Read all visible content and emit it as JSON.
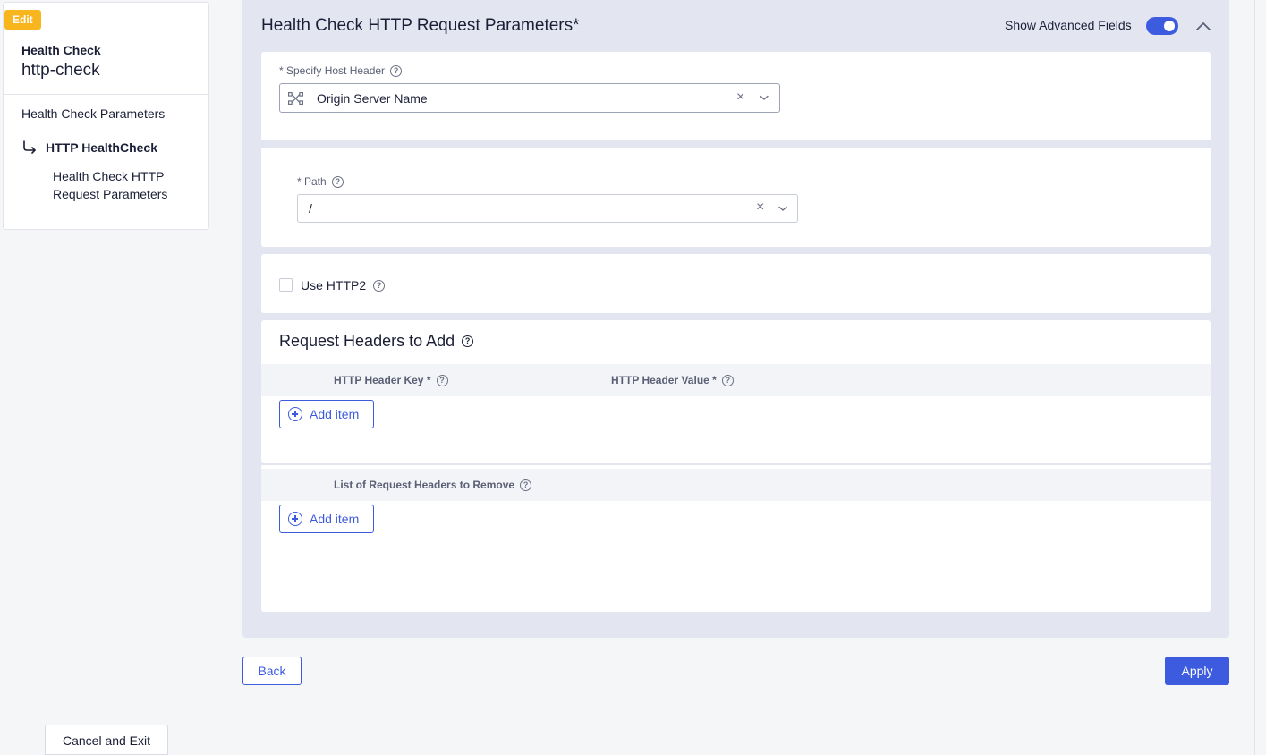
{
  "sidebar": {
    "badge": "Edit",
    "subtitle": "Health Check",
    "title": "http-check",
    "items": [
      {
        "label": "Health Check Parameters"
      },
      {
        "label": "HTTP HealthCheck"
      },
      {
        "label": "Health Check HTTP Request Parameters"
      }
    ],
    "cancel_label": "Cancel and Exit"
  },
  "section": {
    "title": "Health Check HTTP Request Parameters",
    "required_mark": "*",
    "advanced_label": "Show Advanced Fields",
    "advanced_enabled": true
  },
  "host_header": {
    "label": "* Specify Host Header",
    "value": "Origin Server Name",
    "icon": "origin-server-icon"
  },
  "path": {
    "label": "* Path",
    "value": "/"
  },
  "http2": {
    "label": "Use HTTP2",
    "checked": false
  },
  "headers_to_add": {
    "title": "Request Headers to Add",
    "columns": [
      "HTTP Header Key *",
      "HTTP Header Value *"
    ],
    "add_label": "Add item"
  },
  "headers_to_remove": {
    "column": "List of Request Headers to Remove",
    "add_label": "Add item"
  },
  "footer": {
    "back_label": "Back",
    "apply_label": "Apply"
  },
  "colors": {
    "accent": "#3d5bdf",
    "badge": "#f9b51e",
    "section_bg": "#e3e5f1"
  }
}
